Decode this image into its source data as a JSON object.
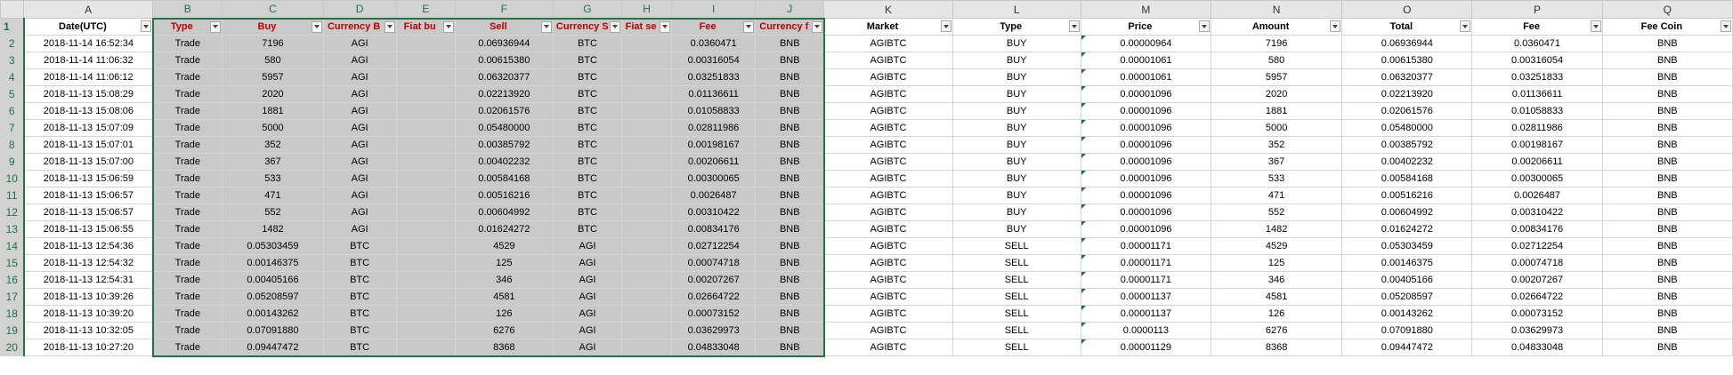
{
  "column_letters": [
    "A",
    "B",
    "C",
    "D",
    "E",
    "F",
    "G",
    "H",
    "I",
    "J",
    "K",
    "L",
    "M",
    "N",
    "O",
    "P",
    "Q"
  ],
  "headers": [
    "Date(UTC)",
    "Type",
    "Buy",
    "Currency B",
    "Fiat bu",
    "Sell",
    "Currency S",
    "Fiat se",
    "Fee",
    "Currency f",
    "Market",
    "Type",
    "Price",
    "Amount",
    "Total",
    "Fee",
    "Fee Coin"
  ],
  "rows": [
    [
      "2018-11-14 16:52:34",
      "Trade",
      "7196",
      "AGI",
      "",
      "0.06936944",
      "BTC",
      "",
      "0.0360471",
      "BNB",
      "AGIBTC",
      "BUY",
      "0.00000964",
      "7196",
      "0.06936944",
      "0.0360471",
      "BNB"
    ],
    [
      "2018-11-14 11:06:32",
      "Trade",
      "580",
      "AGI",
      "",
      "0.00615380",
      "BTC",
      "",
      "0.00316054",
      "BNB",
      "AGIBTC",
      "BUY",
      "0.00001061",
      "580",
      "0.00615380",
      "0.00316054",
      "BNB"
    ],
    [
      "2018-11-14 11:06:12",
      "Trade",
      "5957",
      "AGI",
      "",
      "0.06320377",
      "BTC",
      "",
      "0.03251833",
      "BNB",
      "AGIBTC",
      "BUY",
      "0.00001061",
      "5957",
      "0.06320377",
      "0.03251833",
      "BNB"
    ],
    [
      "2018-11-13 15:08:29",
      "Trade",
      "2020",
      "AGI",
      "",
      "0.02213920",
      "BTC",
      "",
      "0.01136611",
      "BNB",
      "AGIBTC",
      "BUY",
      "0.00001096",
      "2020",
      "0.02213920",
      "0.01136611",
      "BNB"
    ],
    [
      "2018-11-13 15:08:06",
      "Trade",
      "1881",
      "AGI",
      "",
      "0.02061576",
      "BTC",
      "",
      "0.01058833",
      "BNB",
      "AGIBTC",
      "BUY",
      "0.00001096",
      "1881",
      "0.02061576",
      "0.01058833",
      "BNB"
    ],
    [
      "2018-11-13 15:07:09",
      "Trade",
      "5000",
      "AGI",
      "",
      "0.05480000",
      "BTC",
      "",
      "0.02811986",
      "BNB",
      "AGIBTC",
      "BUY",
      "0.00001096",
      "5000",
      "0.05480000",
      "0.02811986",
      "BNB"
    ],
    [
      "2018-11-13 15:07:01",
      "Trade",
      "352",
      "AGI",
      "",
      "0.00385792",
      "BTC",
      "",
      "0.00198167",
      "BNB",
      "AGIBTC",
      "BUY",
      "0.00001096",
      "352",
      "0.00385792",
      "0.00198167",
      "BNB"
    ],
    [
      "2018-11-13 15:07:00",
      "Trade",
      "367",
      "AGI",
      "",
      "0.00402232",
      "BTC",
      "",
      "0.00206611",
      "BNB",
      "AGIBTC",
      "BUY",
      "0.00001096",
      "367",
      "0.00402232",
      "0.00206611",
      "BNB"
    ],
    [
      "2018-11-13 15:06:59",
      "Trade",
      "533",
      "AGI",
      "",
      "0.00584168",
      "BTC",
      "",
      "0.00300065",
      "BNB",
      "AGIBTC",
      "BUY",
      "0.00001096",
      "533",
      "0.00584168",
      "0.00300065",
      "BNB"
    ],
    [
      "2018-11-13 15:06:57",
      "Trade",
      "471",
      "AGI",
      "",
      "0.00516216",
      "BTC",
      "",
      "0.0026487",
      "BNB",
      "AGIBTC",
      "BUY",
      "0.00001096",
      "471",
      "0.00516216",
      "0.0026487",
      "BNB"
    ],
    [
      "2018-11-13 15:06:57",
      "Trade",
      "552",
      "AGI",
      "",
      "0.00604992",
      "BTC",
      "",
      "0.00310422",
      "BNB",
      "AGIBTC",
      "BUY",
      "0.00001096",
      "552",
      "0.00604992",
      "0.00310422",
      "BNB"
    ],
    [
      "2018-11-13 15:06:55",
      "Trade",
      "1482",
      "AGI",
      "",
      "0.01624272",
      "BTC",
      "",
      "0.00834176",
      "BNB",
      "AGIBTC",
      "BUY",
      "0.00001096",
      "1482",
      "0.01624272",
      "0.00834176",
      "BNB"
    ],
    [
      "2018-11-13 12:54:36",
      "Trade",
      "0.05303459",
      "BTC",
      "",
      "4529",
      "AGI",
      "",
      "0.02712254",
      "BNB",
      "AGIBTC",
      "SELL",
      "0.00001171",
      "4529",
      "0.05303459",
      "0.02712254",
      "BNB"
    ],
    [
      "2018-11-13 12:54:32",
      "Trade",
      "0.00146375",
      "BTC",
      "",
      "125",
      "AGI",
      "",
      "0.00074718",
      "BNB",
      "AGIBTC",
      "SELL",
      "0.00001171",
      "125",
      "0.00146375",
      "0.00074718",
      "BNB"
    ],
    [
      "2018-11-13 12:54:31",
      "Trade",
      "0.00405166",
      "BTC",
      "",
      "346",
      "AGI",
      "",
      "0.00207267",
      "BNB",
      "AGIBTC",
      "SELL",
      "0.00001171",
      "346",
      "0.00405166",
      "0.00207267",
      "BNB"
    ],
    [
      "2018-11-13 10:39:26",
      "Trade",
      "0.05208597",
      "BTC",
      "",
      "4581",
      "AGI",
      "",
      "0.02664722",
      "BNB",
      "AGIBTC",
      "SELL",
      "0.00001137",
      "4581",
      "0.05208597",
      "0.02664722",
      "BNB"
    ],
    [
      "2018-11-13 10:39:20",
      "Trade",
      "0.00143262",
      "BTC",
      "",
      "126",
      "AGI",
      "",
      "0.00073152",
      "BNB",
      "AGIBTC",
      "SELL",
      "0.00001137",
      "126",
      "0.00143262",
      "0.00073152",
      "BNB"
    ],
    [
      "2018-11-13 10:32:05",
      "Trade",
      "0.07091880",
      "BTC",
      "",
      "6276",
      "AGI",
      "",
      "0.03629973",
      "BNB",
      "AGIBTC",
      "SELL",
      "0.0000113",
      "6276",
      "0.07091880",
      "0.03629973",
      "BNB"
    ],
    [
      "2018-11-13 10:27:20",
      "Trade",
      "0.09447472",
      "BTC",
      "",
      "8368",
      "AGI",
      "",
      "0.04833048",
      "BNB",
      "AGIBTC",
      "SELL",
      "0.00001129",
      "8368",
      "0.09447472",
      "0.04833048",
      "BNB"
    ]
  ],
  "colors": {
    "selection_border": "#217346",
    "red_header": "#c00000",
    "selected_fill": "#c9c9c9"
  },
  "icons": {
    "filter": "filter-dropdown-icon",
    "text_number_warning": "green-triangle-indicator"
  }
}
